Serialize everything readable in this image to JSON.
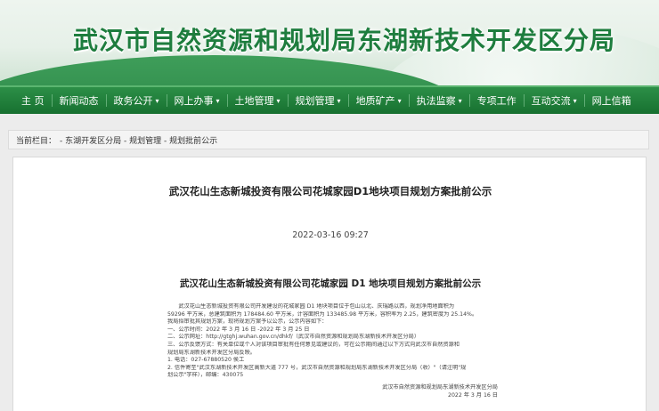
{
  "banner": {
    "title": "武汉市自然资源和规划局东湖新技术开发区分局"
  },
  "nav": {
    "items": [
      {
        "label": "主 页",
        "dropdown": false
      },
      {
        "label": "新闻动态",
        "dropdown": false
      },
      {
        "label": "政务公开",
        "dropdown": true
      },
      {
        "label": "网上办事",
        "dropdown": true
      },
      {
        "label": "土地管理",
        "dropdown": true
      },
      {
        "label": "规划管理",
        "dropdown": true
      },
      {
        "label": "地质矿产",
        "dropdown": true
      },
      {
        "label": "执法监察",
        "dropdown": true
      },
      {
        "label": "专项工作",
        "dropdown": false
      },
      {
        "label": "互动交流",
        "dropdown": true
      },
      {
        "label": "网上信箱",
        "dropdown": false
      }
    ],
    "chevron": "▾"
  },
  "breadcrumb": {
    "prefix": "当前栏目：",
    "path": "- 东湖开发区分局 - 规划管理 - 规划批前公示"
  },
  "article": {
    "title": "武汉花山生态新城投资有限公司花城家园D1地块项目规划方案批前公示",
    "date": "2022-03-16 09:27",
    "inner_title": "武汉花山生态新城投资有限公司花城家园 D1 地块项目规划方案批前公示",
    "paragraphs": [
      "武汉花山生态新城投资有限公司开发建设的花城家园 D1 地块项目位于包山以北、庆瑞路以西，规划净用地面积为",
      "59296 平方米，总建筑面积为 178484.60 平方米，计容面积为 133485.98 平方米，容积率为 2.25，建筑密度为 25.14%。",
      "我局拟审批其规划方案，现将规划方案予以公示，公示内容如下：",
      "一、公示时间：2022 年 3 月 16 日 -2022 年 3 月 25 日",
      "二、公示网址：http://gtghj.wuhan.gov.cn/dhkf/（武汉市自然资源和规划局东湖新技术开发区分局）",
      "三、公示反馈方式：有关单位或个人对该项目审批有任何意见或建议的，可在公示期间通过以下方式向武汉市自然资源和",
      "规划局东湖新技术开发区分局反映。",
      "1. 电话：027-67880520 侯工",
      "2. 信件寄至\"武汉东湖新技术开发区高新大道 777 号，武汉市自然资源和规划局东湖新技术开发区分局（收）\"（请注明\"规",
      "划公示\"字样），邮编：430075"
    ],
    "signature": "武汉市自然资源和规划局东湖新技术开发区分局",
    "sign_date": "2022 年 3 月 16 日"
  }
}
